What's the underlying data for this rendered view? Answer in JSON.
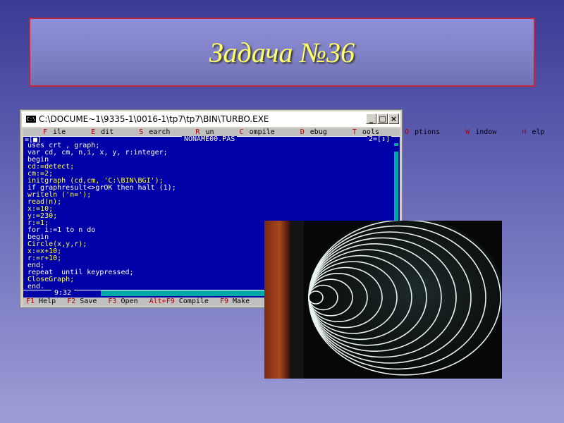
{
  "slide": {
    "title": "Задача №36"
  },
  "window": {
    "title": "C:\\DOCUME~1\\9335-1\\0016-1\\tp7\\tp7\\BIN\\TURBO.EXE",
    "icon": "console-icon",
    "controls": [
      "_",
      "□",
      "×"
    ]
  },
  "menu": {
    "items": [
      {
        "hot": "F",
        "rest": "ile"
      },
      {
        "hot": "E",
        "rest": "dit"
      },
      {
        "hot": "S",
        "rest": "earch"
      },
      {
        "hot": "R",
        "rest": "un"
      },
      {
        "hot": "C",
        "rest": "ompile"
      },
      {
        "hot": "D",
        "rest": "ebug"
      },
      {
        "hot": "T",
        "rest": "ools"
      },
      {
        "hot": "O",
        "rest": "ptions"
      },
      {
        "hot": "W",
        "rest": "indow"
      },
      {
        "hot": "H",
        "rest": "elp"
      }
    ]
  },
  "editor": {
    "frame_left": "=[■]",
    "file_name": "NONAME00.PAS",
    "frame_right": "2=[↕]",
    "cursor_pos": "9:32",
    "lines": [
      {
        "text": "uses crt , graph;",
        "color": "white"
      },
      {
        "text": "var cd, cm, n,i, x, y, r:integer;",
        "color": "white"
      },
      {
        "text": "begin",
        "color": "white"
      },
      {
        "text": "cd:=detect;",
        "color": "yellow"
      },
      {
        "text": "cm:=2;",
        "color": "yellow"
      },
      {
        "text": "initgraph (cd,cm, 'C:\\BIN\\BGI');",
        "color": "yellow"
      },
      {
        "text": "if graphresult<>grOK then halt (1);",
        "color": "white"
      },
      {
        "text": "writeln ('n=');",
        "color": "yellow"
      },
      {
        "text": "read(n);",
        "color": "yellow"
      },
      {
        "text": "x:=10;",
        "color": "yellow"
      },
      {
        "text": "y:=230;",
        "color": "yellow"
      },
      {
        "text": "r:=1;",
        "color": "yellow"
      },
      {
        "text": "for i:=1 to n do",
        "color": "white"
      },
      {
        "text": "begin",
        "color": "white"
      },
      {
        "text": "Circle(x,y,r);",
        "color": "yellow"
      },
      {
        "text": "x:=x+10;",
        "color": "yellow"
      },
      {
        "text": "r:=r+10;",
        "color": "yellow"
      },
      {
        "text": "end;",
        "color": "white"
      },
      {
        "text": "repeat  until keypressed;",
        "color": "white"
      },
      {
        "text": "CloseGraph;",
        "color": "yellow"
      },
      {
        "text": "end.",
        "color": "white"
      }
    ]
  },
  "status": {
    "items": [
      {
        "key": "F1",
        "label": "Help"
      },
      {
        "key": "F2",
        "label": "Save"
      },
      {
        "key": "F3",
        "label": "Open"
      },
      {
        "key": "Alt+F9",
        "label": "Compile"
      },
      {
        "key": "F9",
        "label": "Make"
      }
    ]
  },
  "colors": {
    "editor_bg": "#0000a8",
    "code_yellow": "#ffff55",
    "title_yellow": "#ffff66",
    "title_border": "#c0283a"
  }
}
